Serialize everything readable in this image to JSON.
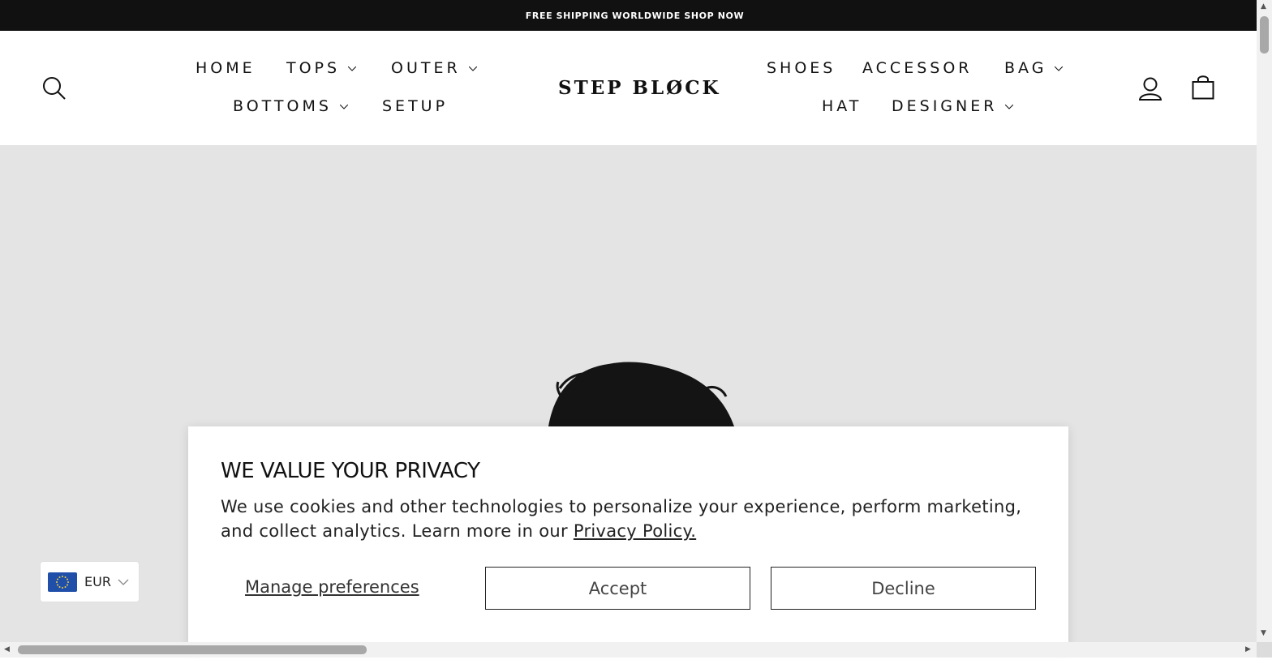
{
  "announcement": {
    "text": "FREE SHIPPING WORLDWIDE SHOP NOW"
  },
  "header": {
    "logo": "STEP BLØCK",
    "nav_left_row1": [
      {
        "label": "HOME",
        "dropdown": false
      },
      {
        "label": "TOPS",
        "dropdown": true
      },
      {
        "label": "OUTER",
        "dropdown": true
      }
    ],
    "nav_left_row2": [
      {
        "label": "BOTTOMS",
        "dropdown": true
      },
      {
        "label": "SETUP",
        "dropdown": false
      }
    ],
    "nav_right_row1": [
      {
        "label": "SHOES",
        "dropdown": false
      },
      {
        "label": "ACCESSOR",
        "dropdown": false
      },
      {
        "label": "BAG",
        "dropdown": true
      }
    ],
    "nav_right_row2": [
      {
        "label": "HAT",
        "dropdown": false
      },
      {
        "label": "DESIGNER",
        "dropdown": true
      }
    ],
    "icons": [
      "search-icon",
      "account-icon",
      "cart-bag-icon"
    ]
  },
  "currency": {
    "code": "EUR",
    "flag": "eu-flag-icon"
  },
  "cookie_banner": {
    "title": "WE VALUE YOUR PRIVACY",
    "body": "We use cookies and other technologies to personalize your experience, perform marketing, and collect analytics. Learn more in our ",
    "policy_link": "Privacy Policy.",
    "manage_label": "Manage preferences",
    "accept_label": "Accept",
    "decline_label": "Decline"
  },
  "colors": {
    "announcement_bg": "#111111",
    "hero_bg": "#e4e4e4",
    "eu_blue": "#1f4fa8"
  }
}
